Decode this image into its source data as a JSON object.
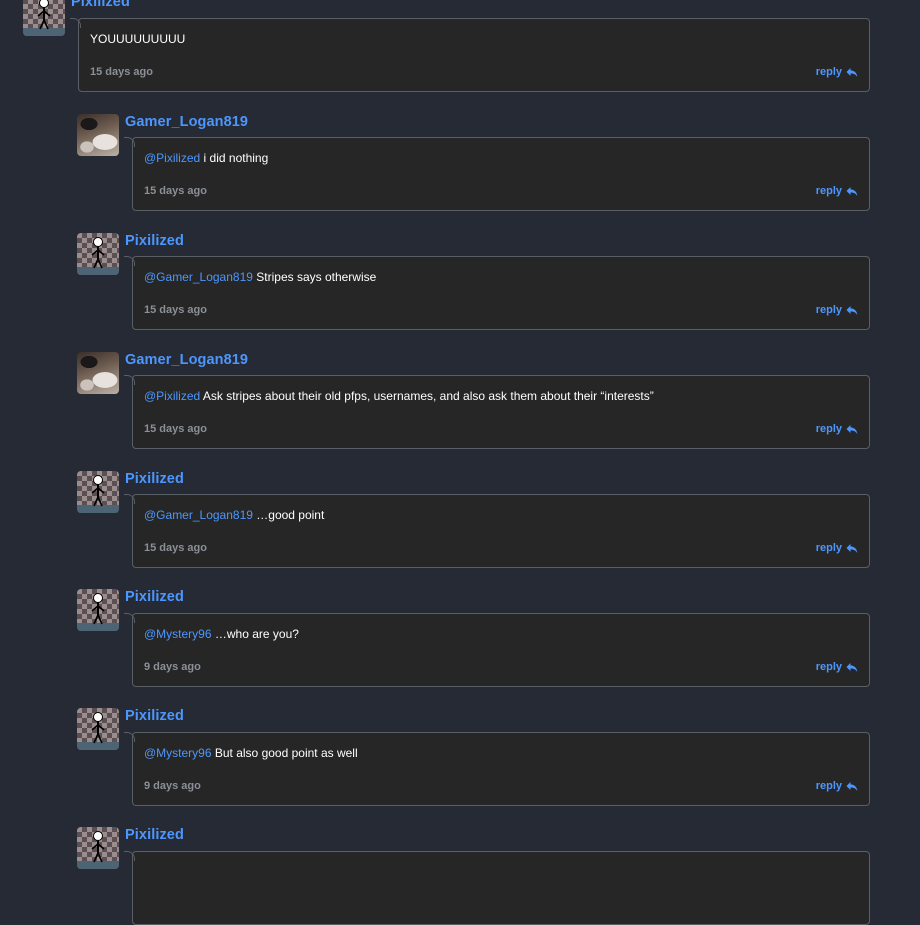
{
  "comments": [
    {
      "user": "Pixilized",
      "avatar": "checker",
      "mention": "",
      "text": "YOUUUUUUUUU",
      "time": "15 days ago",
      "reply": "reply"
    },
    {
      "user": "Gamer_Logan819",
      "avatar": "photo",
      "mention": "@Pixilized",
      "text": "i did nothing",
      "time": "15 days ago",
      "reply": "reply"
    },
    {
      "user": "Pixilized",
      "avatar": "checker",
      "mention": "@Gamer_Logan819",
      "text": "Stripes says otherwise",
      "time": "15 days ago",
      "reply": "reply"
    },
    {
      "user": "Gamer_Logan819",
      "avatar": "photo",
      "mention": "@Pixilized",
      "text": "Ask stripes about their old pfps, usernames, and also ask them about their “interests”",
      "time": "15 days ago",
      "reply": "reply"
    },
    {
      "user": "Pixilized",
      "avatar": "checker",
      "mention": "@Gamer_Logan819",
      "text": "…good point",
      "time": "15 days ago",
      "reply": "reply"
    },
    {
      "user": "Pixilized",
      "avatar": "checker",
      "mention": "@Mystery96",
      "text": "…who are you?",
      "time": "9 days ago",
      "reply": "reply"
    },
    {
      "user": "Pixilized",
      "avatar": "checker",
      "mention": "@Mystery96",
      "text": "But also good point as well",
      "time": "9 days ago",
      "reply": "reply"
    },
    {
      "user": "Pixilized",
      "avatar": "checker",
      "mention": "",
      "text": "",
      "time": "",
      "reply": ""
    }
  ],
  "icons": {
    "reply": "reply-arrow-icon",
    "stick_figure": "stick-figure-icon"
  },
  "colors": {
    "background": "#252a35",
    "bubble": "#262626",
    "border": "#5a5f66",
    "accent": "#4c97ff",
    "muted": "#8b8f96"
  }
}
